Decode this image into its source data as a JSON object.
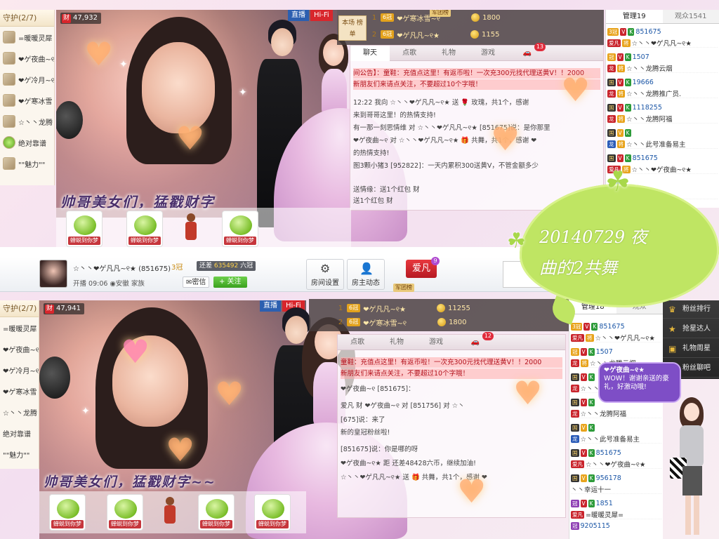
{
  "top": {
    "guard_title": "守护(2/7)",
    "guard_items": [
      "=暖暖灵犀",
      "❤ゲ夜曲~୧",
      "❤ゲ冷月~୧",
      "❤ゲ寒冰雪",
      "☆丶丶龙腾",
      "绝对靠谱",
      "\"\"魅力\"\""
    ],
    "wealth_count": "47,932",
    "zhibo": "直播",
    "hifi": "Hi-Fi",
    "rank_box": "本场\n榜单",
    "rank_rows": [
      {
        "num": "1",
        "name": "❤ゲ寒冰雪~୧",
        "value": "1800"
      },
      {
        "num": "2",
        "name": "❤ゲ凡凡~୧★",
        "value": "1155"
      }
    ],
    "top_name_badge": "军团榜",
    "tabs": [
      "聊天",
      "点歌",
      "礼物",
      "游戏",
      ""
    ],
    "tabs_badge": "13",
    "chat": [
      {
        "kind": "notice",
        "text": "间公告】：童鞋：充值点这里！有返币啦！一次充300元找代理送黄V！！2000"
      },
      {
        "kind": "notice",
        "text": "新朋友们来请点关注，不要超过10个字哦！"
      },
      {
        "kind": "normal",
        "text": "12:22 我向 ☆丶丶❤ゲ凡凡~୧★ 送 🌹 玫瑰，共1个，感谢"
      },
      {
        "kind": "normal",
        "text": "来到哥哥这里！的热情支持!"
      },
      {
        "kind": "normal",
        "text": "有一那一刻思情维 对 ☆丶丶❤ゲ凡凡~୧★ [851675]说：是你那里"
      },
      {
        "kind": "normal",
        "text": "❤ゲ夜曲~୧ 对 ☆丶丶❤ゲ凡凡~୧★ 🎁 共舞，共1个，感谢 ❤"
      },
      {
        "kind": "normal",
        "text": "的热情支持!"
      },
      {
        "kind": "normal",
        "text": "图3颗小猪3 [952822]：一天内累积300送黄V，不管金额多少"
      },
      {
        "kind": "normal",
        "text": ""
      },
      {
        "kind": "normal",
        "text": "送情缘：送1个红包 财"
      },
      {
        "kind": "normal",
        "text": "送1个红包 财"
      }
    ],
    "users_tabs": [
      "管理19",
      "观众1541"
    ],
    "users": [
      {
        "l1": "851675",
        "l2": "☆丶丶❤ゲ凡凡~୧★"
      },
      {
        "l1": "1507",
        "l2": "☆丶丶龙腾云烟"
      },
      {
        "l1": "19666",
        "l2": "☆丶丶龙腾推广员."
      },
      {
        "l1": "1118255",
        "l2": "☆丶丶龙腾阿福"
      },
      {
        "l1": "",
        "l2": "☆丶丶此号准备易主"
      },
      {
        "l1": "851675",
        "l2": "☆丶丶❤ゲ夜曲~୧★"
      },
      {
        "l1": "178",
        "l2": ""
      }
    ],
    "caption": "帅哥美女们，猛戳财字"
  },
  "overlay": {
    "speech_line1": "20140729 夜",
    "speech_line2": "曲的2共舞"
  },
  "bottom": {
    "streamer_name": "☆丶丶❤ゲ凡凡~୧★ (851675)",
    "level": "3",
    "need_label": "还差",
    "need_value": "635492",
    "need_unit": "六冠",
    "start_label": "开播",
    "start_time": "09:06",
    "location": "安徽",
    "family_label": "家族",
    "msg_btn": "密信",
    "follow_btn": "+ 关注",
    "room_settings": "房间设置",
    "host_news": "房主动态",
    "logo_text": "爱凡",
    "logo_level": "9",
    "army_badge": "军团榜",
    "guard_title": "守护(2/7)",
    "guard_items": [
      "=暖暖灵犀",
      "❤ゲ夜曲~୧",
      "❤ゲ冷月~୧",
      "❤ゲ寒冰雪",
      "☆丶丶龙腾",
      "绝对靠谱",
      "\"\"魅力\"\""
    ],
    "wealth_count": "47,941",
    "zhibo": "直播",
    "hifi": "Hi-Fi",
    "rank_rows": [
      {
        "num": "1",
        "name": "❤ゲ凡凡~୧★",
        "value": "11255"
      },
      {
        "num": "2",
        "name": "❤ゲ寒冰雪~୧",
        "value": "1800"
      }
    ],
    "tabs": [
      "点歌",
      "礼物",
      "游戏",
      ""
    ],
    "tabs_badge": "12",
    "chat": [
      {
        "kind": "notice",
        "text": "童鞋：充值点这里！有返币啦！一次充300元找代理送黄V！！2000"
      },
      {
        "kind": "notice",
        "text": "新朋友们来请点关注，不要超过10个字哦！"
      },
      {
        "kind": "normal",
        "text": "❤ゲ夜曲~୧ [851675]："
      },
      {
        "kind": "normal",
        "text": "爱凡 财 ❤ゲ夜曲~୧ 对 [851756] 对 ☆丶"
      },
      {
        "kind": "normal",
        "text": "[675]说：来了"
      },
      {
        "kind": "normal",
        "text": "新的皇冠粉丝啦!"
      },
      {
        "kind": "normal",
        "text": "[851675]说：你是哪的呀"
      },
      {
        "kind": "normal",
        "text": "❤ゲ夜曲~୧★ 距 还差48428六币，继续加油!"
      },
      {
        "kind": "normal",
        "text": "☆丶丶❤ゲ凡凡~୧★ 送 🎁 共舞，共1个，感谢 ❤"
      }
    ],
    "users_tabs": [
      "管理18",
      "观众"
    ],
    "users": [
      {
        "l1": "851675",
        "l2": "☆丶丶❤ゲ凡凡~୧★"
      },
      {
        "l1": "1507",
        "l2": "☆丶丶龙腾云烟"
      },
      {
        "l1": "",
        "l2": "☆丶丶龙腾推广员"
      },
      {
        "l1": "",
        "l2": "☆丶丶龙腾阿福"
      },
      {
        "l1": "",
        "l2": "☆丶丶此号准备易主"
      },
      {
        "l1": "851675",
        "l2": "☆丶丶❤ゲ夜曲~୧★"
      },
      {
        "l1": "956178",
        "l2": "丶丶幸运十一"
      },
      {
        "l1": "1851",
        "l2": "=暖暖灵犀="
      },
      {
        "l1": "9205115",
        "l2": ""
      }
    ],
    "bubble_title": "❤ゲ夜曲~୧★",
    "bubble_text": "WOW！谢谢亲送的豪礼，好激动哦!",
    "side_menu": [
      "粉丝排行",
      "抢星达人",
      "礼物周星",
      "粉丝聊吧"
    ],
    "caption": "帅哥美女们，猛戳财字~~"
  },
  "colors": {
    "accent_red": "#d8262c",
    "accent_green": "#3aa11e",
    "speech_green": "#bfe563"
  }
}
